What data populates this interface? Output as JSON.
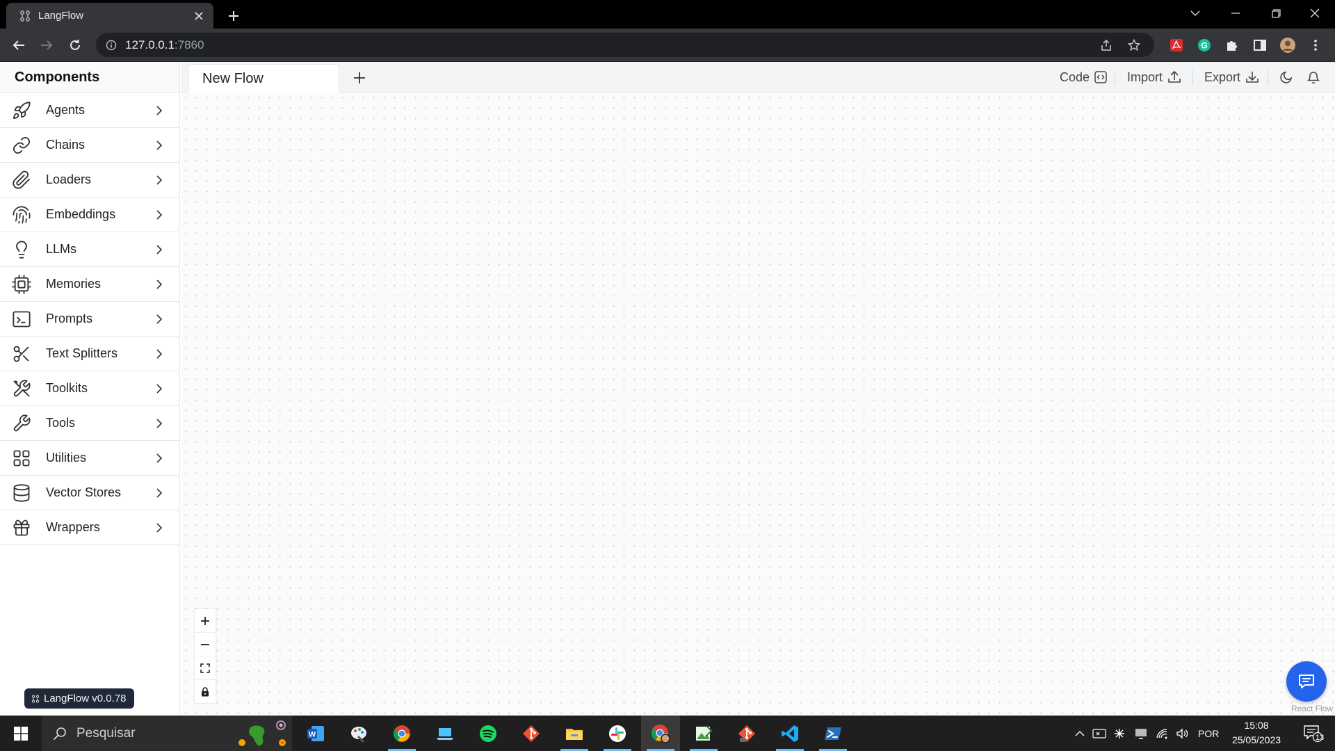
{
  "browser": {
    "tab_title": "LangFlow",
    "url_host": "127.0.0.1",
    "url_port": ":7860"
  },
  "sidebar": {
    "title": "Components",
    "items": [
      {
        "label": "Agents",
        "icon": "rocket-icon"
      },
      {
        "label": "Chains",
        "icon": "link-icon"
      },
      {
        "label": "Loaders",
        "icon": "paperclip-icon"
      },
      {
        "label": "Embeddings",
        "icon": "fingerprint-icon"
      },
      {
        "label": "LLMs",
        "icon": "lightbulb-icon"
      },
      {
        "label": "Memories",
        "icon": "cpu-icon"
      },
      {
        "label": "Prompts",
        "icon": "terminal-icon"
      },
      {
        "label": "Text Splitters",
        "icon": "scissors-icon"
      },
      {
        "label": "Toolkits",
        "icon": "tools-icon"
      },
      {
        "label": "Tools",
        "icon": "wrench-icon"
      },
      {
        "label": "Utilities",
        "icon": "grid-icon"
      },
      {
        "label": "Vector Stores",
        "icon": "database-icon"
      },
      {
        "label": "Wrappers",
        "icon": "gift-icon"
      }
    ],
    "version": "LangFlow v0.0.78"
  },
  "header": {
    "flow_tab": "New Flow",
    "code_label": "Code",
    "import_label": "Import",
    "export_label": "Export"
  },
  "canvas": {
    "attribution": "React Flow"
  },
  "taskbar": {
    "search_placeholder": "Pesquisar",
    "language": "POR",
    "time": "15:08",
    "date": "25/05/2023",
    "notification_count": "13"
  },
  "colors": {
    "accent": "#2563eb",
    "browser_dark": "#35363a",
    "badge_bg": "#1f2937"
  }
}
